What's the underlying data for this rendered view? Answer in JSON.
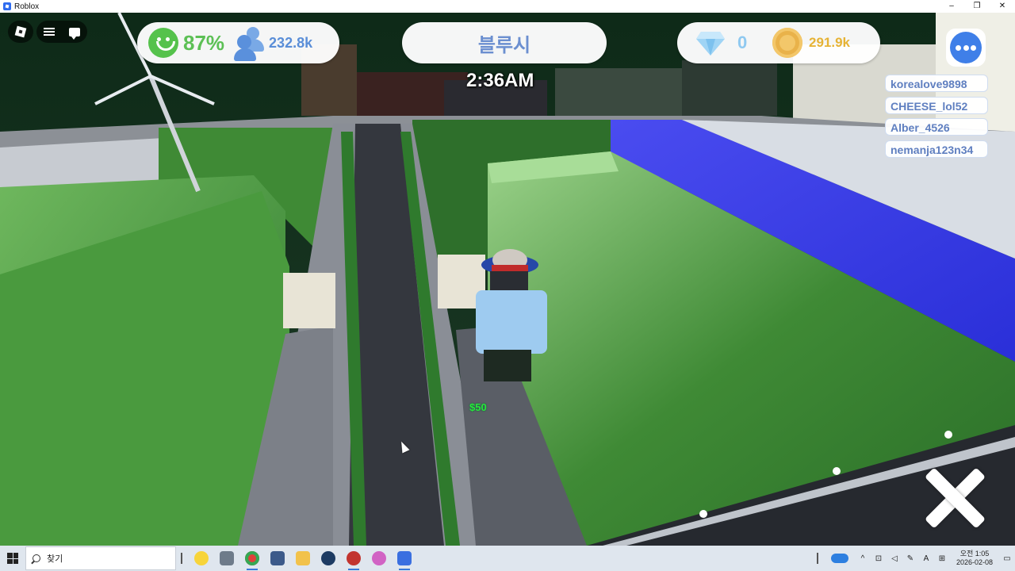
{
  "window": {
    "title": "Roblox",
    "controls": [
      "–",
      "❐",
      "✕"
    ]
  },
  "hud": {
    "happiness": "87%",
    "population": "232.8k",
    "location": "블루시",
    "gems": "0",
    "coins": "291.9k",
    "time": "2:36AM",
    "floating_money": "$50"
  },
  "players": [
    "korealove9898",
    "CHEESE_lol52",
    "Alber_4526",
    "nemanja123n34"
  ],
  "taskbar": {
    "search_placeholder": "찾기",
    "clock_time": "오전 1:05",
    "clock_date": "2026-02-08",
    "tray_lang": "A",
    "apps": [
      {
        "name": "kakaotalk",
        "color": "#f7d43a"
      },
      {
        "name": "calculator",
        "color": "#6e7b8a"
      },
      {
        "name": "chrome",
        "color": "#e0413a"
      },
      {
        "name": "app",
        "color": "#3c5a8a"
      },
      {
        "name": "file-explorer",
        "color": "#f2c24b"
      },
      {
        "name": "steam",
        "color": "#1d3b63"
      },
      {
        "name": "app",
        "color": "#c2342f"
      },
      {
        "name": "app",
        "color": "#d163c4"
      },
      {
        "name": "roblox",
        "color": "#3a6fe0"
      }
    ]
  }
}
